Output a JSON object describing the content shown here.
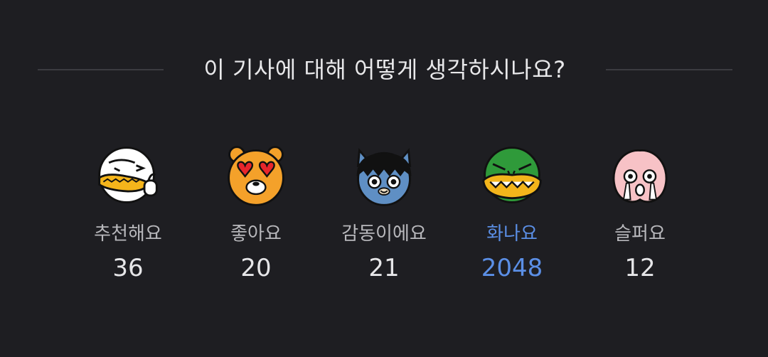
{
  "question": "이 기사에 대해 어떻게 생각하시나요?",
  "accent_color": "#5b8fe6",
  "reactions": [
    {
      "label": "추천해요",
      "count": "36",
      "icon": "thumbs-up-duck-icon"
    },
    {
      "label": "좋아요",
      "count": "20",
      "icon": "heart-eyes-bear-icon"
    },
    {
      "label": "감동이에요",
      "count": "21",
      "icon": "teary-cat-icon"
    },
    {
      "label": "화나요",
      "count": "2048",
      "icon": "angry-crocodile-icon",
      "selected": true
    },
    {
      "label": "슬퍼요",
      "count": "12",
      "icon": "crying-peach-icon"
    }
  ]
}
